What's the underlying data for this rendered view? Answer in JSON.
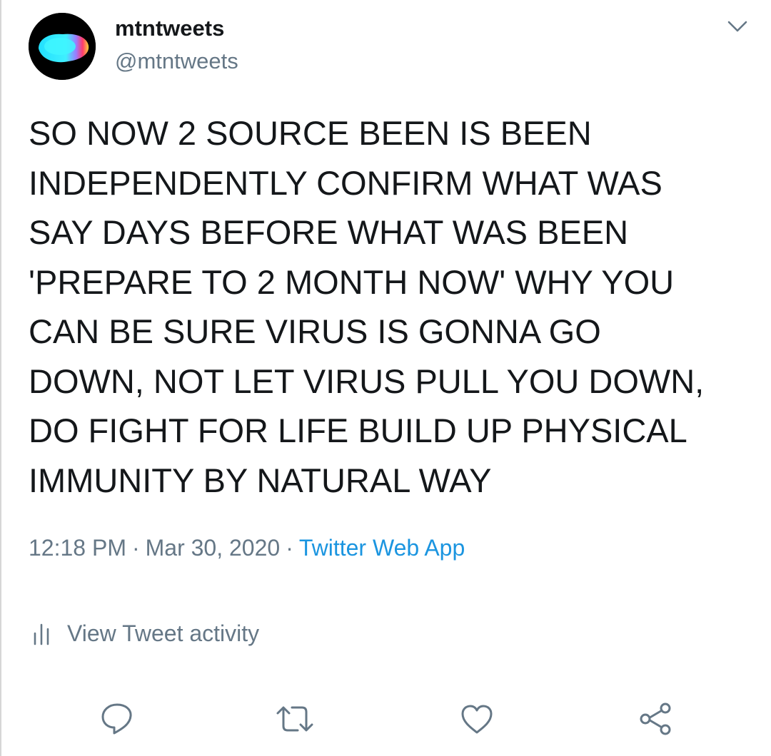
{
  "tweet": {
    "display_name": "mtntweets",
    "handle": "@mtntweets",
    "text": "SO NOW 2 SOURCE BEEN IS BEEN\nINDEPENDENTLY CONFIRM WHAT WAS\nSAY DAYS BEFORE WHAT WAS BEEN\n'PREPARE TO 2 MONTH NOW' WHY YOU\nCAN BE SURE VIRUS IS GONNA GO\nDOWN, NOT LET VIRUS PULL YOU DOWN,\nDO FIGHT FOR LIFE BUILD UP PHYSICAL\nIMMUNITY BY NATURAL WAY",
    "time": "12:18 PM",
    "separator": "·",
    "date": "Mar 30, 2020",
    "source": "Twitter Web App",
    "activity_label": "View Tweet activity"
  },
  "icons": {
    "more": "chevron-down-icon",
    "activity": "bar-chart-icon",
    "reply": "reply-icon",
    "retweet": "retweet-icon",
    "like": "heart-icon",
    "share": "share-icon"
  },
  "colors": {
    "text_primary": "#14171a",
    "text_secondary": "#657786",
    "link": "#1b95e0",
    "icon_gray": "#657786"
  }
}
